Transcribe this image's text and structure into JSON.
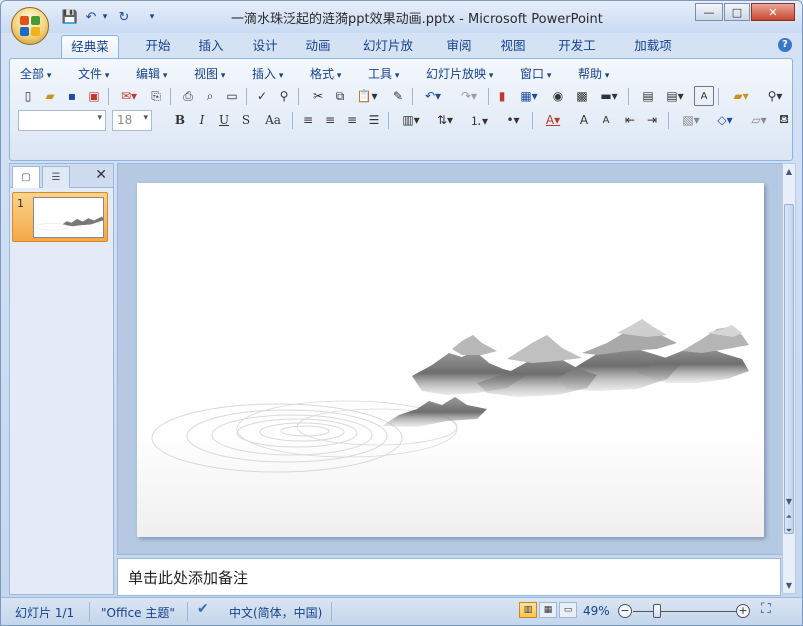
{
  "window": {
    "title": "一滴水珠泛起的涟漪ppt效果动画.pptx - Microsoft PowerPoint",
    "controls": {
      "minimize": "—",
      "maximize": "□",
      "close": "✕"
    }
  },
  "qat": {
    "save": "💾",
    "undo": "↶",
    "redo": "↻",
    "more": "▾"
  },
  "ribbon_tabs": [
    "经典菜单",
    "开始",
    "插入",
    "设计",
    "动画",
    "幻灯片放映",
    "审阅",
    "视图",
    "开发工具",
    "加载项"
  ],
  "menus": [
    "全部",
    "文件",
    "编辑",
    "视图",
    "插入",
    "格式",
    "工具",
    "幻灯片放映",
    "窗口",
    "帮助"
  ],
  "toolbar": {
    "font_name": "",
    "font_size": "18",
    "bold": "B",
    "italic": "I",
    "underline": "U",
    "shadow": "S",
    "case": "Aa"
  },
  "slides_panel": {
    "slide_number": "1"
  },
  "notes": {
    "placeholder": "单击此处添加备注"
  },
  "status": {
    "slide_info": "幻灯片 1/1",
    "theme": "\"Office 主题\"",
    "language": "中文(简体，中国)",
    "zoom": "49%",
    "zoom_level": 0.49
  }
}
